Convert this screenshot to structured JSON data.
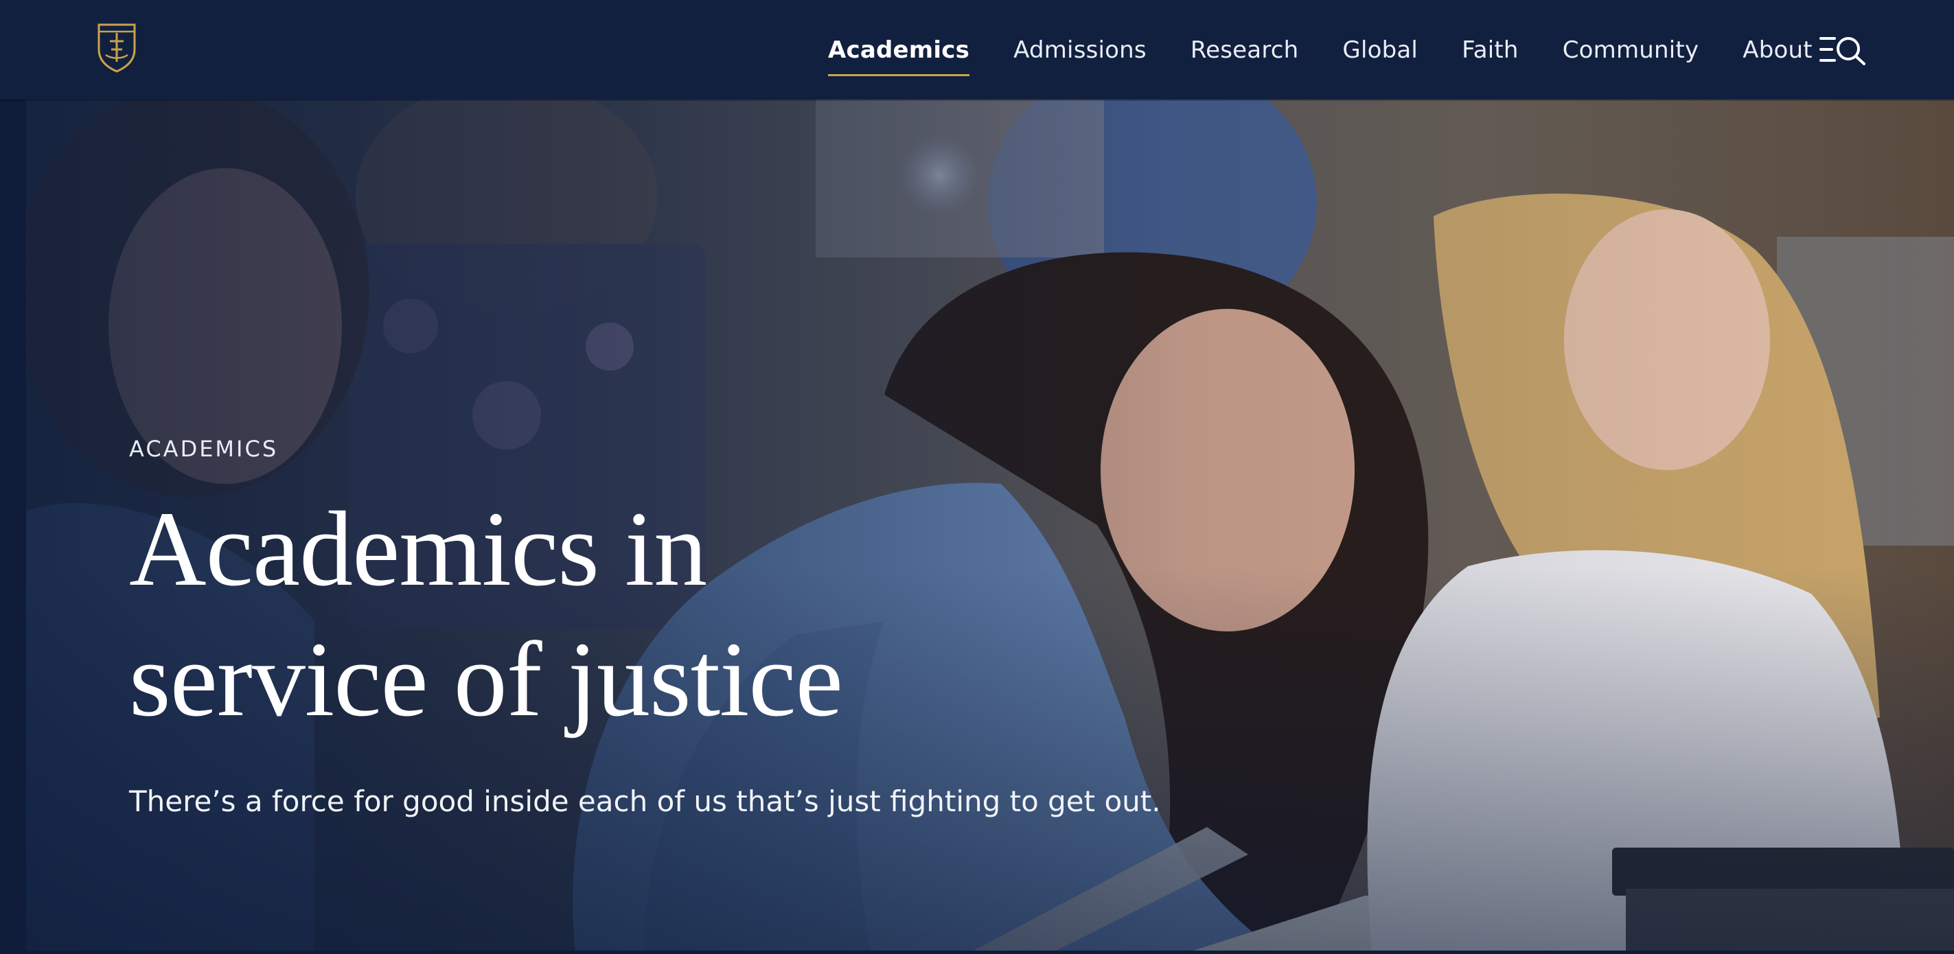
{
  "header": {
    "logo_icon": "university-crest-icon",
    "nav": [
      {
        "label": "Academics",
        "active": true
      },
      {
        "label": "Admissions",
        "active": false
      },
      {
        "label": "Research",
        "active": false
      },
      {
        "label": "Global",
        "active": false
      },
      {
        "label": "Faith",
        "active": false
      },
      {
        "label": "Community",
        "active": false
      },
      {
        "label": "About",
        "active": false
      }
    ],
    "menu_search_icon": "menu-search-icon"
  },
  "hero": {
    "eyebrow": "ACADEMICS",
    "headline_line1": "Academics in",
    "headline_line2": "service of justice",
    "subtitle": "There’s a force for good inside each of us that’s just fighting to get out."
  },
  "colors": {
    "header_bg": "#12203f",
    "accent_gold": "#c9a34b",
    "text_white": "#ffffff"
  }
}
